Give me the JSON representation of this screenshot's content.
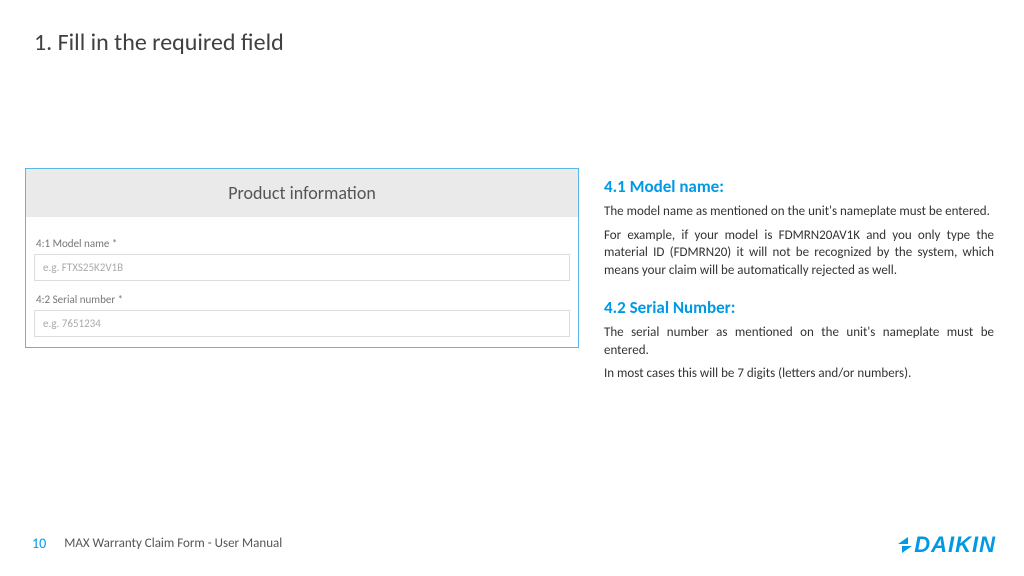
{
  "page_title": "1. Fill in the required field",
  "form": {
    "panel_title": "Product information",
    "fields": [
      {
        "label": "4:1 Model name *",
        "placeholder": "e.g. FTXS25K2V1B"
      },
      {
        "label": "4:2 Serial number *",
        "placeholder": "e.g. 7651234"
      }
    ]
  },
  "sections": [
    {
      "heading": "4.1 Model name:",
      "paras": [
        "The model name as mentioned on the unit's nameplate must be entered.",
        "For example, if your model is FDMRN20AV1K and you only type the material ID (FDMRN20) it will not be recognized by the system, which means your claim will be automatically rejected as well."
      ]
    },
    {
      "heading": "4.2 Serial Number:",
      "paras": [
        "The serial number as mentioned on the unit's nameplate must be entered.",
        "In most cases this will be 7 digits (letters and/or numbers)."
      ]
    }
  ],
  "footer": {
    "page_number": "10",
    "doc_title": "MAX Warranty Claim Form - User Manual"
  },
  "brand": "DAIKIN"
}
